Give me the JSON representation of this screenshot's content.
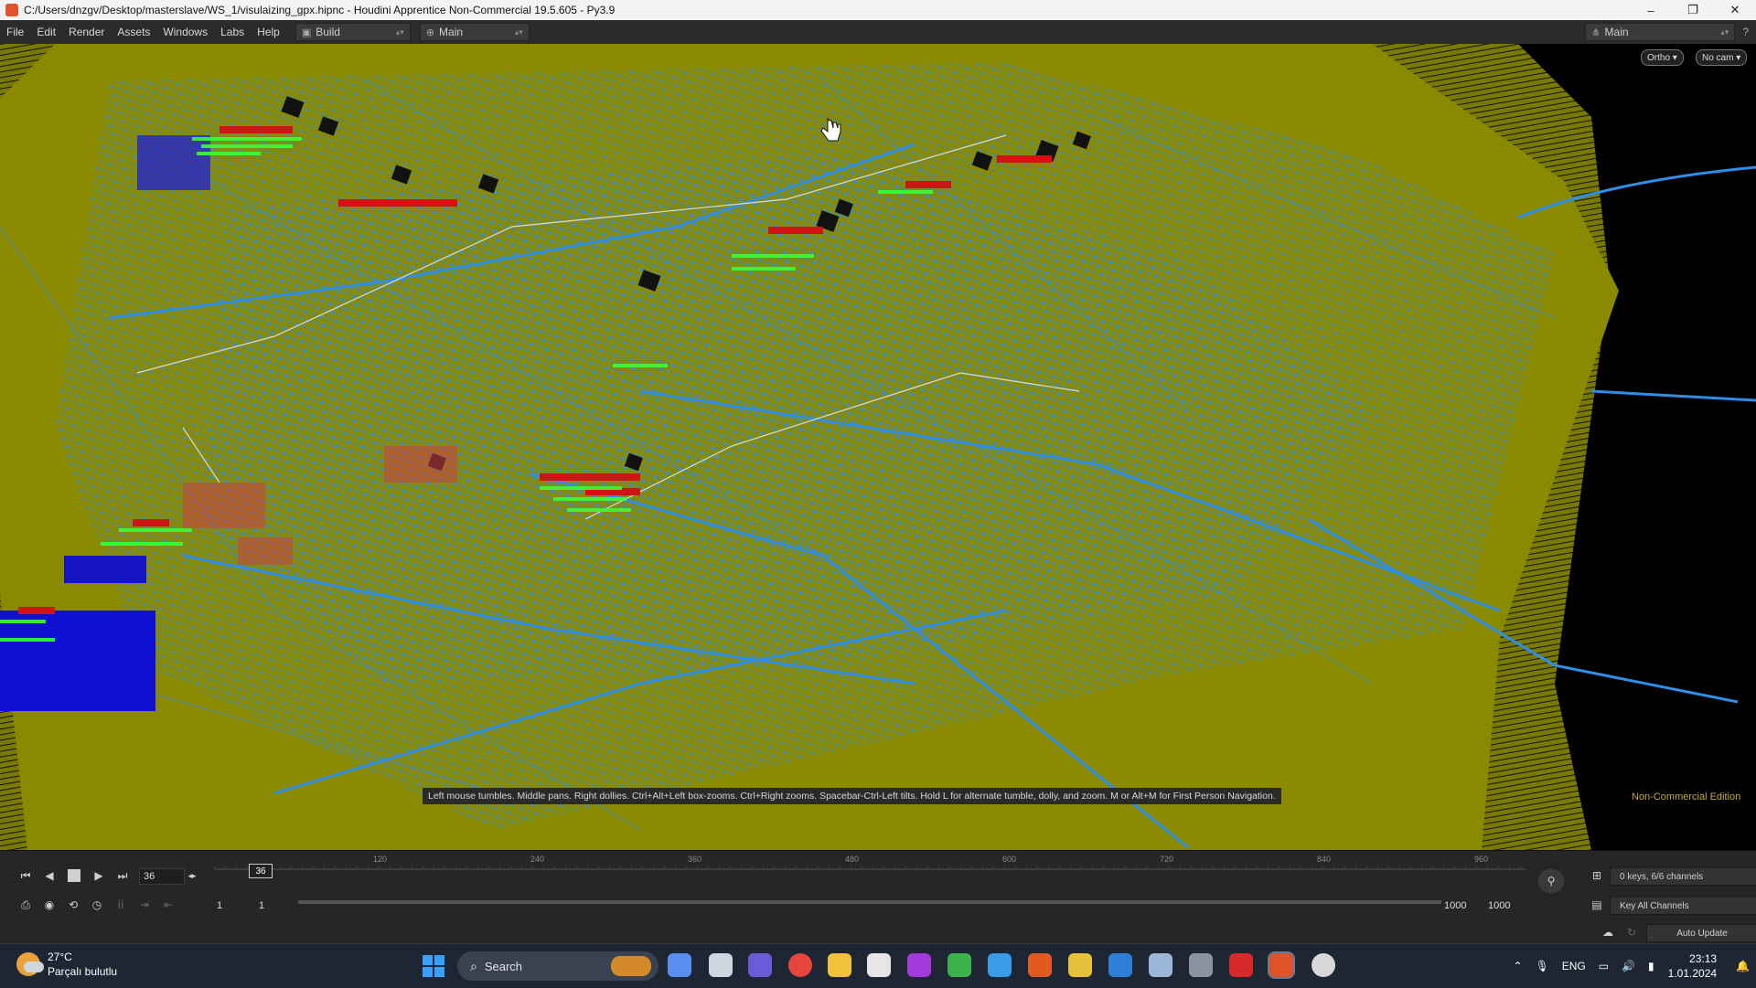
{
  "window": {
    "title": "C:/Users/dnzgv/Desktop/masterslave/WS_1/visulaizing_gpx.hipnc - Houdini Apprentice Non-Commercial 19.5.605 - Py3.9",
    "min": "–",
    "max": "❐",
    "close": "✕"
  },
  "menubar": {
    "items": [
      "File",
      "Edit",
      "Render",
      "Assets",
      "Windows",
      "Labs",
      "Help"
    ],
    "desktop": "Build",
    "pane": "Main",
    "right_desktop": "Main"
  },
  "viewport": {
    "ortho_btn": "Ortho ▾",
    "camera_btn": "No cam ▾",
    "hint": "Left mouse tumbles. Middle pans. Right dollies. Ctrl+Alt+Left box-zooms. Ctrl+Right zooms. Spacebar-Ctrl-Left tilts. Hold L for alternate tumble, dolly, and zoom.    M or Alt+M for First Person Navigation.",
    "watermark": "Non-Commercial Edition",
    "colors": {
      "ground": "#8a8a00",
      "wire": "#2f8fe8",
      "label_text": "#37ff37",
      "label_bg": "#d01414"
    }
  },
  "timeline": {
    "current_frame": "36",
    "cursor_frame": "36",
    "ticks": [
      "120",
      "240",
      "360",
      "480",
      "600",
      "720",
      "840",
      "960"
    ],
    "range_start": "1",
    "range_start2": "1",
    "range_end": "1000",
    "range_end2": "1000",
    "keys_info": "0 keys, 6/6 channels",
    "key_all": "Key All Channels",
    "auto_update": "Auto Update"
  },
  "taskbar": {
    "temperature": "27°C",
    "weather_desc": "Parçalı bulutlu",
    "search_label": "Search",
    "language": "ENG",
    "time": "23:13",
    "date": "1.01.2024"
  }
}
